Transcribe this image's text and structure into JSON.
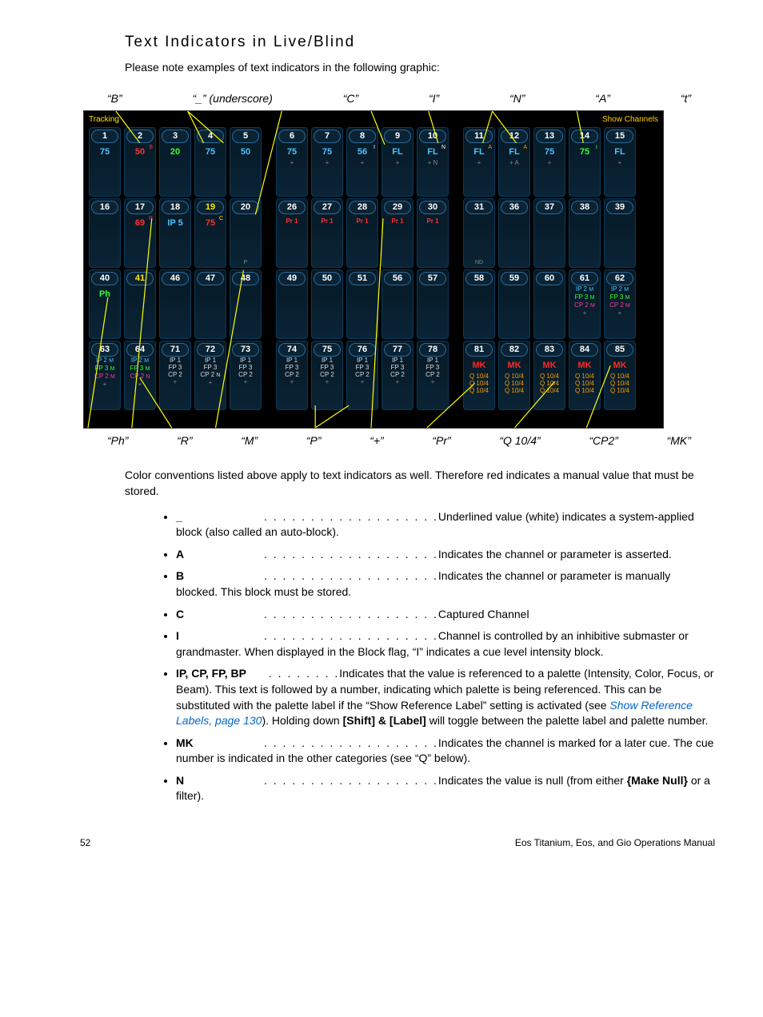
{
  "heading": "Text Indicators in Live/Blind",
  "intro": "Please note examples of text indicators in the following graphic:",
  "top_callouts": [
    "“B”",
    "“_” (underscore)",
    "“C”",
    "“I”",
    "“N”",
    "“A”",
    "“t”"
  ],
  "bottom_callouts": [
    "“Ph”",
    "“R”",
    "“M”",
    "“P”",
    "“+”",
    "“Pr”",
    "“Q 10/4”",
    "“CP2”",
    "“MK”"
  ],
  "panel": {
    "tracking": "Tracking",
    "show_channels": "Show Channels"
  },
  "chart_data": {
    "type": "table",
    "rows": [
      {
        "group": 1,
        "cells": [
          {
            "n": "1",
            "v": "75",
            "c": "blue"
          },
          {
            "n": "2",
            "v": "50",
            "c": "red",
            "sup": "B",
            "supc": "r"
          },
          {
            "n": "3",
            "v": "20",
            "c": "green"
          },
          {
            "n": "4",
            "v": "75",
            "c": "blue"
          },
          {
            "n": "5",
            "v": "50",
            "c": "blue"
          },
          null,
          {
            "n": "6",
            "v": "75",
            "c": "blue",
            "plus": "+"
          },
          {
            "n": "7",
            "v": "75",
            "c": "blue",
            "plus": "+"
          },
          {
            "n": "8",
            "v": "56",
            "c": "blue",
            "sup": "I",
            "supc": "w",
            "plus": "+"
          },
          {
            "n": "9",
            "v": "FL",
            "c": "blue",
            "plus": "+"
          },
          {
            "n": "10",
            "v": "FL",
            "c": "blue",
            "sup": "N",
            "supc": "w",
            "plus": "+ N"
          },
          null,
          {
            "n": "11",
            "v": "FL",
            "c": "blue",
            "sup": "A",
            "supc": "o",
            "plus": "+"
          },
          {
            "n": "12",
            "v": "FL",
            "c": "blue",
            "sup": "A",
            "supc": "o",
            "plus": "+ A"
          },
          {
            "n": "13",
            "v": "75",
            "c": "blue",
            "plus": "+"
          },
          {
            "n": "14",
            "v": "75",
            "c": "green",
            "sup": "t",
            "supc": "g"
          },
          {
            "n": "15",
            "v": "FL",
            "c": "blue",
            "plus": "+"
          }
        ]
      },
      {
        "group": 2,
        "cells": [
          {
            "n": "16"
          },
          {
            "n": "17",
            "v": "69",
            "c": "red",
            "sup": "R",
            "supc": "r"
          },
          {
            "n": "18",
            "v": "IP 5",
            "c": "blue"
          },
          {
            "n": "19",
            "ny": true,
            "v": "75",
            "c": "red",
            "sup": "C",
            "supc": "y"
          },
          {
            "n": "20",
            "note": "P"
          },
          null,
          {
            "n": "26",
            "v": "Pr 1",
            "c": "red",
            "tiny": true
          },
          {
            "n": "27",
            "v": "Pr 1",
            "c": "red",
            "tiny": true
          },
          {
            "n": "28",
            "v": "Pr 1",
            "c": "red",
            "tiny": true
          },
          {
            "n": "29",
            "v": "Pr 1",
            "c": "red",
            "tiny": true
          },
          {
            "n": "30",
            "v": "Pr 1",
            "c": "red",
            "tiny": true
          },
          null,
          {
            "n": "31",
            "note": "ND"
          },
          {
            "n": "36"
          },
          {
            "n": "37"
          },
          {
            "n": "38"
          },
          {
            "n": "39"
          }
        ]
      },
      {
        "group": 3,
        "cells": [
          {
            "n": "40",
            "v": "Ph",
            "c": "green"
          },
          {
            "n": "41",
            "ny": true
          },
          {
            "n": "46"
          },
          {
            "n": "47"
          },
          {
            "n": "48"
          },
          null,
          {
            "n": "49"
          },
          {
            "n": "50"
          },
          {
            "n": "51"
          },
          {
            "n": "56"
          },
          {
            "n": "57"
          },
          null,
          {
            "n": "58"
          },
          {
            "n": "59"
          },
          {
            "n": "60"
          },
          {
            "n": "61",
            "lines": [
              {
                "t": "IP 2",
                "c": "blu",
                "sup": "M"
              },
              {
                "t": "FP 3",
                "c": "grn",
                "sup": "M"
              },
              {
                "t": "CP 2",
                "c": "mag",
                "sup": "M"
              }
            ],
            "plus": "+"
          },
          {
            "n": "62",
            "lines": [
              {
                "t": "IP 2",
                "c": "blu",
                "sup": "M"
              },
              {
                "t": "FP 3",
                "c": "grn",
                "sup": "M"
              },
              {
                "t": "CP 2",
                "c": "mag",
                "sup": "M"
              }
            ],
            "plus": "+"
          }
        ]
      },
      {
        "group": 4,
        "cells": [
          {
            "n": "63",
            "lines": [
              {
                "t": "IP 2",
                "c": "blu",
                "sup": "M"
              },
              {
                "t": "FP 3",
                "c": "grn",
                "sup": "M"
              },
              {
                "t": "CP 2",
                "c": "mag",
                "sup": "M"
              }
            ],
            "plus": "+"
          },
          {
            "n": "64",
            "lines": [
              {
                "t": "IP 2",
                "c": "blu",
                "sup": "M"
              },
              {
                "t": "FP 3",
                "c": "grn",
                "sup": "M"
              },
              {
                "t": "CP 2",
                "c": "mag",
                "sup": "N"
              }
            ],
            "plus": "+"
          },
          {
            "n": "71",
            "lines": [
              {
                "t": "IP 1",
                "c": "red"
              },
              {
                "t": "FP 3",
                "c": "red"
              },
              {
                "t": "CP 2",
                "c": "red"
              }
            ],
            "plus": "+"
          },
          {
            "n": "72",
            "lines": [
              {
                "t": "IP 1",
                "c": "red"
              },
              {
                "t": "FP 3",
                "c": "red"
              },
              {
                "t": "CP 2",
                "c": "red",
                "sup": "N"
              }
            ],
            "plus": "+"
          },
          {
            "n": "73",
            "lines": [
              {
                "t": "IP 1",
                "c": "red"
              },
              {
                "t": "FP 3",
                "c": "red"
              },
              {
                "t": "CP 2",
                "c": "red"
              }
            ],
            "plus": "+"
          },
          null,
          {
            "n": "74",
            "lines": [
              {
                "t": "IP 1",
                "c": "red"
              },
              {
                "t": "FP 3",
                "c": "red"
              },
              {
                "t": "CP 2",
                "c": "red"
              }
            ],
            "plus": "+"
          },
          {
            "n": "75",
            "lines": [
              {
                "t": "IP 1",
                "c": "red"
              },
              {
                "t": "FP 3",
                "c": "red"
              },
              {
                "t": "CP 2",
                "c": "red"
              }
            ],
            "plus": "+"
          },
          {
            "n": "76",
            "lines": [
              {
                "t": "IP 1",
                "c": "red"
              },
              {
                "t": "FP 3",
                "c": "red"
              },
              {
                "t": "CP 2",
                "c": "red"
              }
            ],
            "plus": "+"
          },
          {
            "n": "77",
            "lines": [
              {
                "t": "IP 1",
                "c": "red"
              },
              {
                "t": "FP 3",
                "c": "red"
              },
              {
                "t": "CP 2",
                "c": "red"
              }
            ],
            "plus": "+"
          },
          {
            "n": "78",
            "lines": [
              {
                "t": "IP 1",
                "c": "red"
              },
              {
                "t": "FP 3",
                "c": "red"
              },
              {
                "t": "CP 2",
                "c": "red"
              }
            ],
            "plus": "+"
          },
          null,
          {
            "n": "81",
            "mk": "MK",
            "q": [
              "Q 10/4",
              "Q 10/4",
              "Q 10/4"
            ]
          },
          {
            "n": "82",
            "mk": "MK",
            "q": [
              "Q 10/4",
              "Q 10/4",
              "Q 10/4"
            ]
          },
          {
            "n": "83",
            "mk": "MK",
            "q": [
              "Q 10/4",
              "Q 10/4",
              "Q 10/4"
            ]
          },
          {
            "n": "84",
            "mk": "MK",
            "q": [
              "Q 10/4",
              "Q 10/4",
              "Q 10/4"
            ]
          },
          {
            "n": "85",
            "mk": "MK",
            "q": [
              "Q 10/4",
              "Q 10/4",
              "Q 10/4"
            ]
          }
        ]
      }
    ]
  },
  "body_p": "Color conventions listed above apply to text indicators as well. Therefore red indicates a manual value that must be stored.",
  "defs": [
    {
      "term": "_",
      "def": "Underlined value (white) indicates a system-applied block (also called an auto-block)."
    },
    {
      "term": "A",
      "def": "Indicates the channel or parameter is asserted."
    },
    {
      "term": "B",
      "def": "Indicates the channel or parameter is manually blocked. This block must be stored."
    },
    {
      "term": "C",
      "def": "Captured Channel"
    },
    {
      "term": "I",
      "def": "Channel is controlled by an inhibitive submaster or grandmaster. When displayed in the Block flag, “I” indicates a cue level intensity block."
    },
    {
      "term": "IP, CP, FP, BP",
      "def_pre": "Indicates that the value is referenced to a palette (Intensity, Color, Focus, or Beam). This text is followed by a number, indicating which palette is being referenced. This can be substituted with the palette label if the “Show Reference Label” setting is activated (see ",
      "link": "Show Reference Labels, page 130",
      "def_post": "). Holding down [Shift] & [Label] will toggle between the palette label and palette number."
    },
    {
      "term": "MK",
      "def": "Indicates the channel is marked for a later cue. The cue number is indicated in the other categories (see “Q” below)."
    },
    {
      "term": "N",
      "def_pre": "Indicates the value is null (from either ",
      "em": "{Make Null}",
      "def_post": " or a filter)."
    }
  ],
  "footer": {
    "page": "52",
    "doc": "Eos Titanium, Eos, and Gio Operations Manual"
  }
}
